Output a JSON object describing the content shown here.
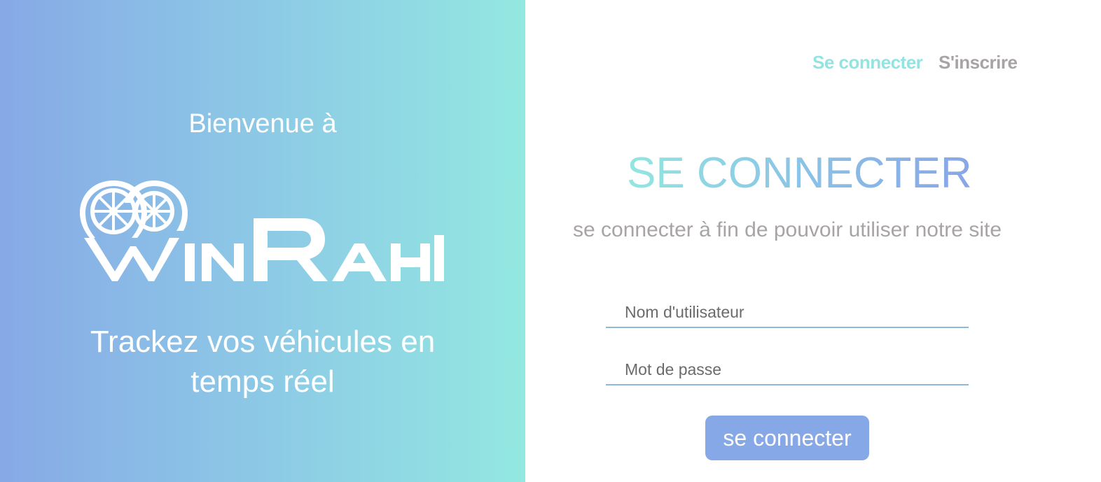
{
  "left_panel": {
    "welcome": "Bienvenue à",
    "logo_text": "WINRAHI",
    "tagline": "Trackez vos véhicules en temps réel"
  },
  "nav": {
    "login": "Se connecter",
    "signup": "S'inscrire"
  },
  "form": {
    "title": "SE CONNECTER",
    "subtitle": "se connecter à fin de pouvoir utiliser notre site",
    "username_placeholder": "Nom d'utilisateur",
    "password_placeholder": "Mot de passe",
    "submit": "se connecter"
  },
  "colors": {
    "gradient_start": "#87a9e6",
    "gradient_end": "#93e8e1",
    "nav_active": "#93e4e0",
    "nav_inactive": "#a8a4a4",
    "button": "#87a8e6"
  }
}
